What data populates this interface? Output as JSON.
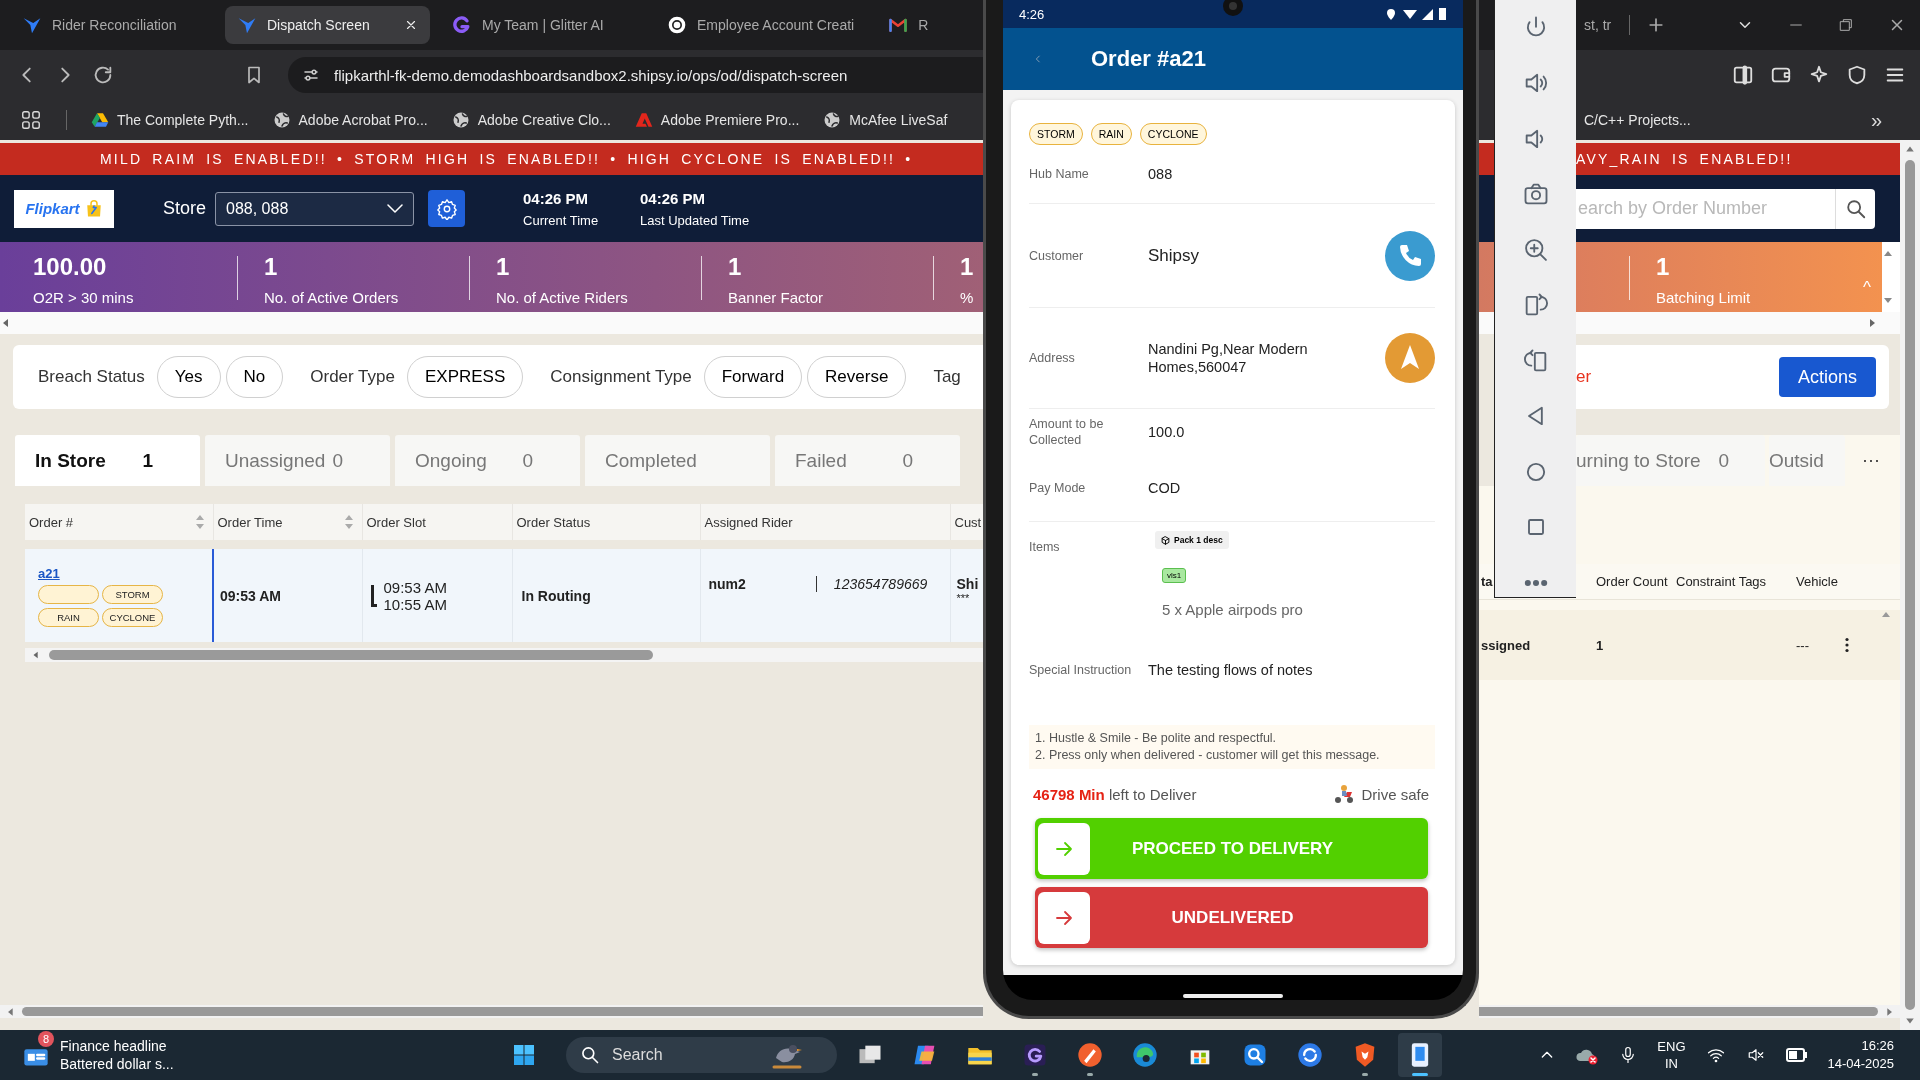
{
  "browser": {
    "tabs": [
      {
        "title": "Rider Reconciliation",
        "selected": false
      },
      {
        "title": "Dispatch Screen",
        "selected": true
      },
      {
        "title": "My Team | Glitter AI",
        "selected": false
      },
      {
        "title": "Employee Account Creati",
        "selected": false
      },
      {
        "title": "R",
        "selected": false
      }
    ],
    "tabs_right": [
      {
        "title": "st, tr",
        "selected": false
      }
    ],
    "url": "flipkarthl-fk-demo.demodashboardsandbox2.shipsy.io/ops/od/dispatch-screen",
    "bookmarks": [
      "The Complete Pyth...",
      "Adobe Acrobat Pro...",
      "Adobe Creative Clo...",
      "Adobe Premiere Pro...",
      "McAfee LiveSaf"
    ],
    "bookmarks_right": [
      "C/C++ Projects..."
    ],
    "overflow": "»"
  },
  "alert_banner": {
    "text": "MILD RAIM IS ENABLED!! • STORM HIGH IS ENABLED!! • HIGH CYCLONE IS ENABLED!! •",
    "text_right": "AVY_RAIN IS ENABLED!!"
  },
  "header": {
    "logo": "Flipkart",
    "store_label": "Store",
    "store": "088, 088",
    "times": [
      {
        "time": "04:26 PM",
        "label": "Current Time"
      },
      {
        "time": "04:26 PM",
        "label": "Last Updated Time"
      }
    ],
    "search_placeholder": "earch by Order Number"
  },
  "metrics": [
    {
      "value": "100.00",
      "label": "O2R > 30 mins"
    },
    {
      "value": "1",
      "label": "No. of Active Orders"
    },
    {
      "value": "1",
      "label": "No. of Active Riders"
    },
    {
      "value": "1",
      "label": "Banner Factor"
    },
    {
      "value": "1",
      "label": "%"
    }
  ],
  "metrics_right": [
    {
      "value": "1",
      "label": "Batching Limit"
    }
  ],
  "metrics_collapse": "^",
  "filters": [
    {
      "kind": "label",
      "text": "Breach Status"
    },
    {
      "kind": "chip",
      "text": "Yes"
    },
    {
      "kind": "chip",
      "text": "No"
    },
    {
      "kind": "label",
      "text": "Order Type"
    },
    {
      "kind": "chip",
      "text": "EXPRESS"
    },
    {
      "kind": "label",
      "text": "Consignment Type"
    },
    {
      "kind": "chip",
      "text": "Forward"
    },
    {
      "kind": "chip",
      "text": "Reverse"
    },
    {
      "kind": "label",
      "text": "Tag"
    }
  ],
  "filter_link": "er",
  "actions_button": "Actions",
  "status_tabs": [
    {
      "label": "In Store",
      "count": "1",
      "selected": true
    },
    {
      "label": "Unassigned",
      "count": "0",
      "selected": false
    },
    {
      "label": "Ongoing",
      "count": "0",
      "selected": false
    },
    {
      "label": "Completed",
      "selected": false
    },
    {
      "label": "Failed",
      "count": "0",
      "selected": false
    }
  ],
  "status_tabs_right": [
    {
      "label": "urning to Store",
      "count": "0",
      "selected": false
    },
    {
      "label": "Outsid",
      "selected": false
    }
  ],
  "more_tabs": "···",
  "table": {
    "columns": [
      {
        "label": "Order #",
        "sortable": true
      },
      {
        "label": "Order Time",
        "sortable": true
      },
      {
        "label": "Order Slot",
        "sortable": false
      },
      {
        "label": "Order Status",
        "sortable": false
      },
      {
        "label": "Assigned Rider",
        "sortable": false
      },
      {
        "label": "Cust"
      }
    ],
    "rows": [
      {
        "order": "a21",
        "blank_tag": true,
        "tags": [
          "STORM",
          "RAIN",
          "CYCLONE"
        ],
        "order_time": "09:53 AM",
        "slot": [
          "09:53 AM",
          "10:55 AM"
        ],
        "status": "In Routing",
        "rider": "num2",
        "rider_phone": "123654789669",
        "customer": "Shi",
        "customer_phone": "***"
      }
    ]
  },
  "table_right": {
    "columns": [
      "ta",
      "Order Count",
      "Constraint Tags",
      "Vehicle"
    ],
    "rows": [
      {
        "status": "ssigned",
        "order_count": "1",
        "vehicle": "---"
      }
    ]
  },
  "phone": {
    "time": "4:26",
    "title": "Order #a21",
    "tags": [
      "STORM",
      "RAIN",
      "CYCLONE"
    ],
    "fields": [
      {
        "kind": "text",
        "label": "Hub Name",
        "value": "088",
        "divider": true
      },
      {
        "kind": "call",
        "label": "Customer",
        "value": "Shipsy",
        "divider": true
      },
      {
        "kind": "navigate",
        "label": "Address",
        "value": "Nandini Pg,Near Modern Homes,560047",
        "divider": true
      },
      {
        "kind": "text",
        "label": "Amount to be Collected",
        "value": "100.0",
        "divider": false
      },
      {
        "kind": "text",
        "label": "Pay Mode",
        "value": "COD",
        "divider": true
      },
      {
        "kind": "items",
        "label": "Items",
        "pack": "Pack 1 desc",
        "chip": "vls1",
        "value": "5 x Apple airpods pro",
        "divider": false
      },
      {
        "kind": "text",
        "label": "Special Instruction",
        "value": "The testing flows of notes",
        "divider": false
      }
    ],
    "notes": [
      "1. Hustle & Smile - Be polite and respectful.",
      "2. Press only when delivered - customer will get this message."
    ],
    "time_left": "46798 Min",
    "time_left_suffix": "left to Deliver",
    "drive_safe": "Drive safe",
    "actions": [
      {
        "kind": "proceed",
        "label": "PROCEED TO DELIVERY"
      },
      {
        "kind": "undelivered",
        "label": "UNDELIVERED"
      }
    ]
  },
  "taskbar": {
    "widget": {
      "badge": "8",
      "title": "Finance headline",
      "text": "Battered dollar s..."
    },
    "search_placeholder": "Search",
    "apps": [
      {
        "running": false,
        "active": false
      },
      {
        "running": false,
        "active": false
      },
      {
        "running": false,
        "active": false
      },
      {
        "running": true,
        "active": false
      },
      {
        "running": true,
        "active": false
      },
      {
        "running": false,
        "active": false
      },
      {
        "running": false,
        "active": false
      },
      {
        "running": false,
        "active": false
      },
      {
        "running": false,
        "active": false
      },
      {
        "running": true,
        "active": false
      },
      {
        "running": true,
        "active": true
      }
    ],
    "language": "ENG",
    "region": "IN",
    "time": "16:26",
    "date": "14-04-2025"
  }
}
